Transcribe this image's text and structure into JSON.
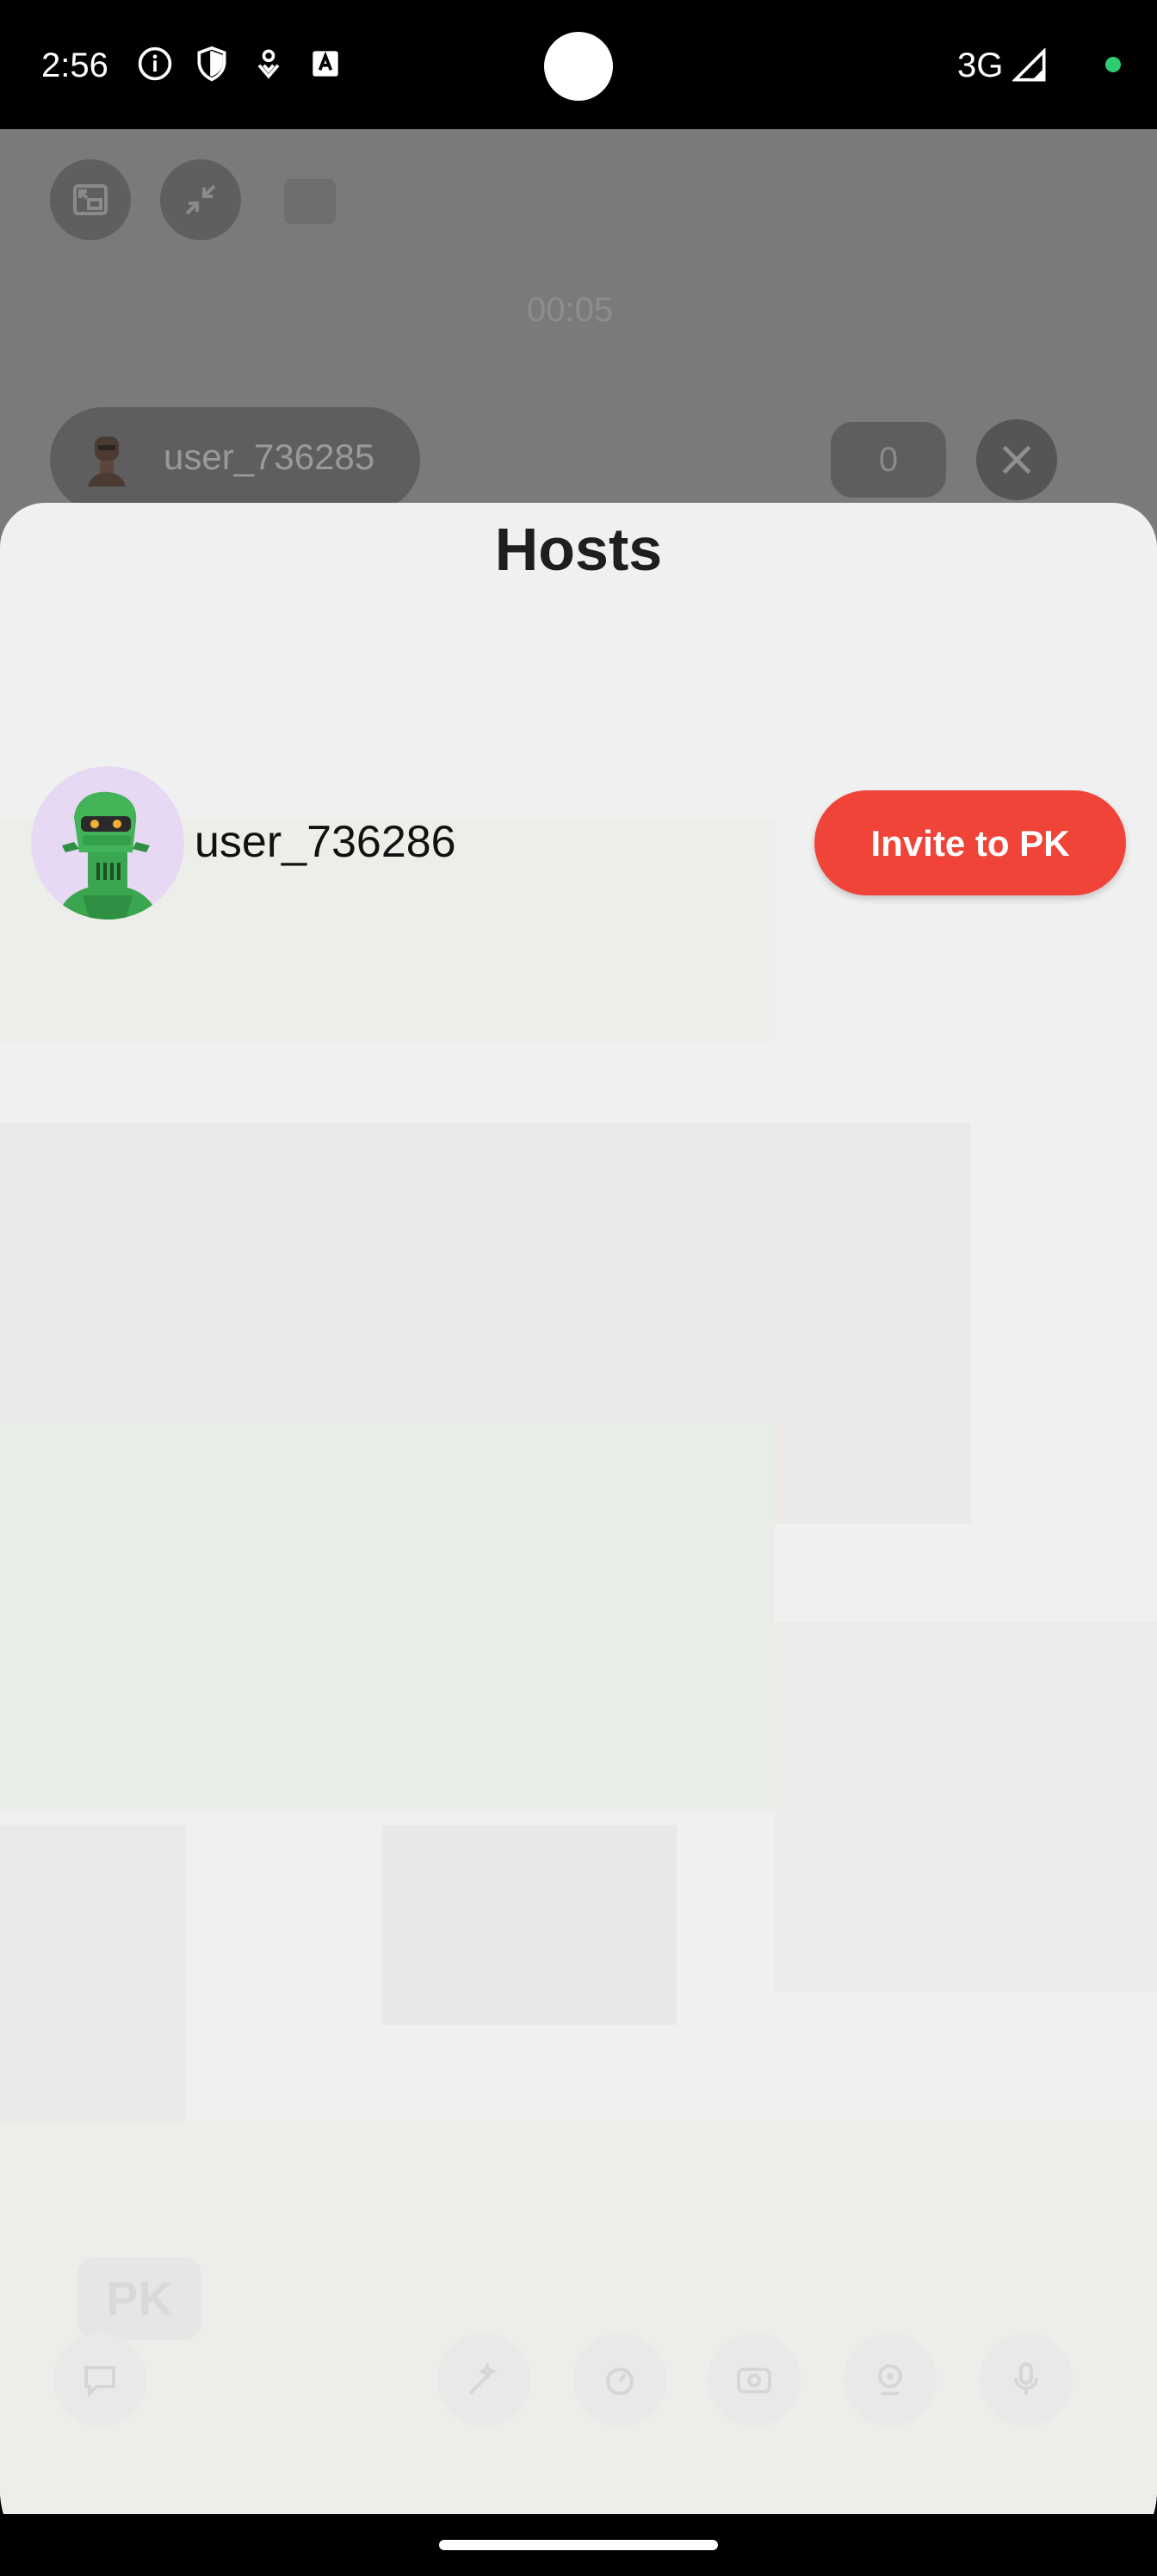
{
  "status_bar": {
    "time": "2:56",
    "network": "3G",
    "icons": [
      "info-icon",
      "shield-icon",
      "vpn-icon",
      "keyboard-icon",
      "signal-icon"
    ],
    "dot_color": "#2ecc71"
  },
  "room": {
    "timer": "00:05",
    "host_name": "user_736285",
    "viewer_count": "0",
    "buttons": [
      "pip-icon",
      "minimize-icon",
      "screen-icon",
      "close-icon"
    ]
  },
  "sheet": {
    "title": "Hosts",
    "hosts": [
      {
        "name": "user_736286",
        "invite_label": "Invite to PK",
        "avatar": "robot-avatar-icon"
      }
    ],
    "pk_label": "PK",
    "controls": [
      "chat-icon",
      "beauty-icon",
      "effects-icon",
      "flip-camera-icon",
      "camera-icon",
      "microphone-icon"
    ]
  },
  "colors": {
    "accent": "#f04438",
    "sheet_bg": "#f0f0f0",
    "avatar_bg": "#e7d9f4"
  }
}
